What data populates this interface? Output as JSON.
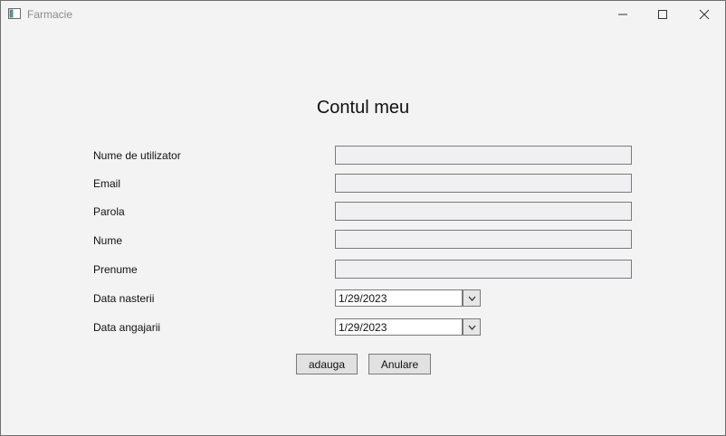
{
  "window": {
    "title": "Farmacie",
    "icons": {
      "app": "window-app-icon",
      "minimize": "minimize-icon",
      "maximize": "maximize-icon",
      "close": "close-icon"
    }
  },
  "form": {
    "heading": "Contul meu",
    "fields": {
      "username": {
        "label": "Nume de utilizator",
        "value": ""
      },
      "email": {
        "label": "Email",
        "value": ""
      },
      "password": {
        "label": "Parola",
        "value": ""
      },
      "lastname": {
        "label": "Nume",
        "value": ""
      },
      "firstname": {
        "label": "Prenume",
        "value": ""
      }
    },
    "dates": {
      "birth": {
        "label": "Data nasterii",
        "value": "1/29/2023",
        "icon": "chevron-down-icon"
      },
      "hire": {
        "label": "Data angajarii",
        "value": "1/29/2023",
        "icon": "chevron-down-icon"
      }
    },
    "buttons": {
      "add": "adauga",
      "cancel": "Anulare"
    }
  }
}
